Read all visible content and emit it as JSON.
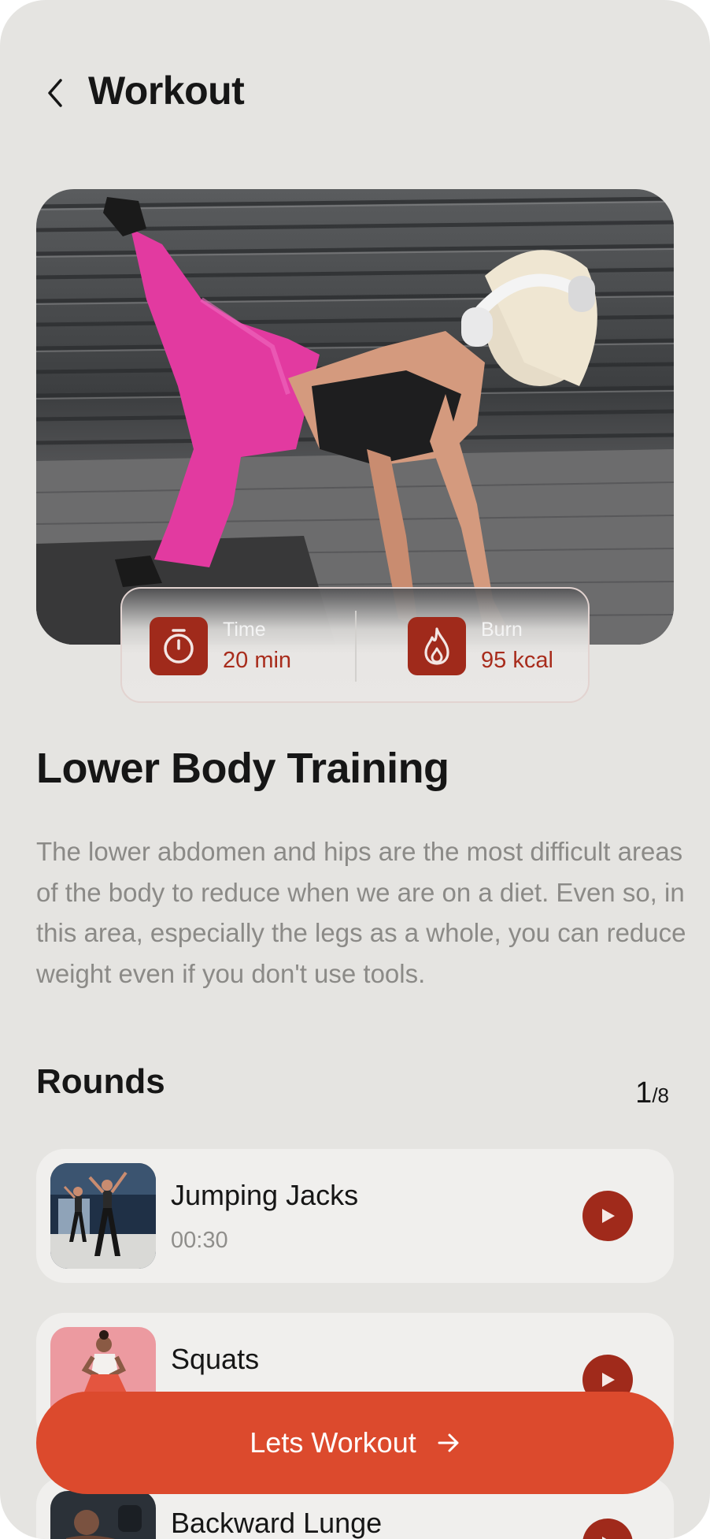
{
  "header": {
    "title": "Workout"
  },
  "stats": [
    {
      "label": "Time",
      "value": "20 min",
      "icon": "stopwatch-icon"
    },
    {
      "label": "Burn",
      "value": "95 kcal",
      "icon": "flame-icon"
    }
  ],
  "workout": {
    "title": "Lower Body Training",
    "description": "The lower abdomen and hips are the most difficult areas of the body to reduce when we are on a diet. Even so, in this area, especially the legs as a whole, you can reduce weight even if you don't use tools."
  },
  "rounds": {
    "title": "Rounds",
    "current": "1",
    "total": "/8",
    "items": [
      {
        "name": "Jumping Jacks",
        "duration": "00:30"
      },
      {
        "name": "Squats",
        "duration": ""
      },
      {
        "name": "Backward Lunge",
        "duration": ""
      }
    ]
  },
  "cta": {
    "label": "Lets Workout"
  },
  "colors": {
    "background": "#e5e4e1",
    "accent": "#a02a1b",
    "cta": "#dc4a2d",
    "card": "#f0efed"
  }
}
